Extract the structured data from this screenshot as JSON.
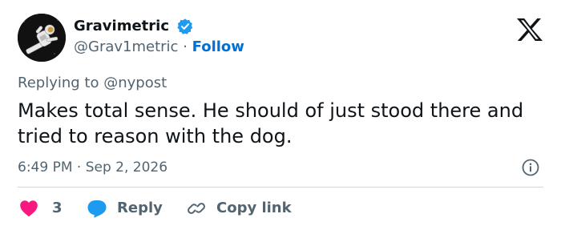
{
  "author": {
    "display_name": "Gravimetric",
    "handle": "@Grav1metric",
    "separator": "·",
    "follow_label": "Follow",
    "avatar_icon": "astronaut-avatar",
    "verified_icon": "verified-badge-icon"
  },
  "header": {
    "logo_icon": "x-logo-icon"
  },
  "reply_context": {
    "prefix": "Replying to",
    "mention": "@nypost"
  },
  "tweet": {
    "text": "Makes total sense. He should of just stood there and tried to reason with the dog.",
    "time": "6:49 PM",
    "separator": "·",
    "date": "Sep 2, 2026"
  },
  "actions": {
    "like_count": "3",
    "reply_label": "Reply",
    "copy_link_label": "Copy link"
  },
  "colors": {
    "accent": "#1d9bf0",
    "link": "#006fd6",
    "like": "#f91880",
    "text": "#0f1419",
    "muted": "#536471",
    "divider": "#cfd9de"
  }
}
